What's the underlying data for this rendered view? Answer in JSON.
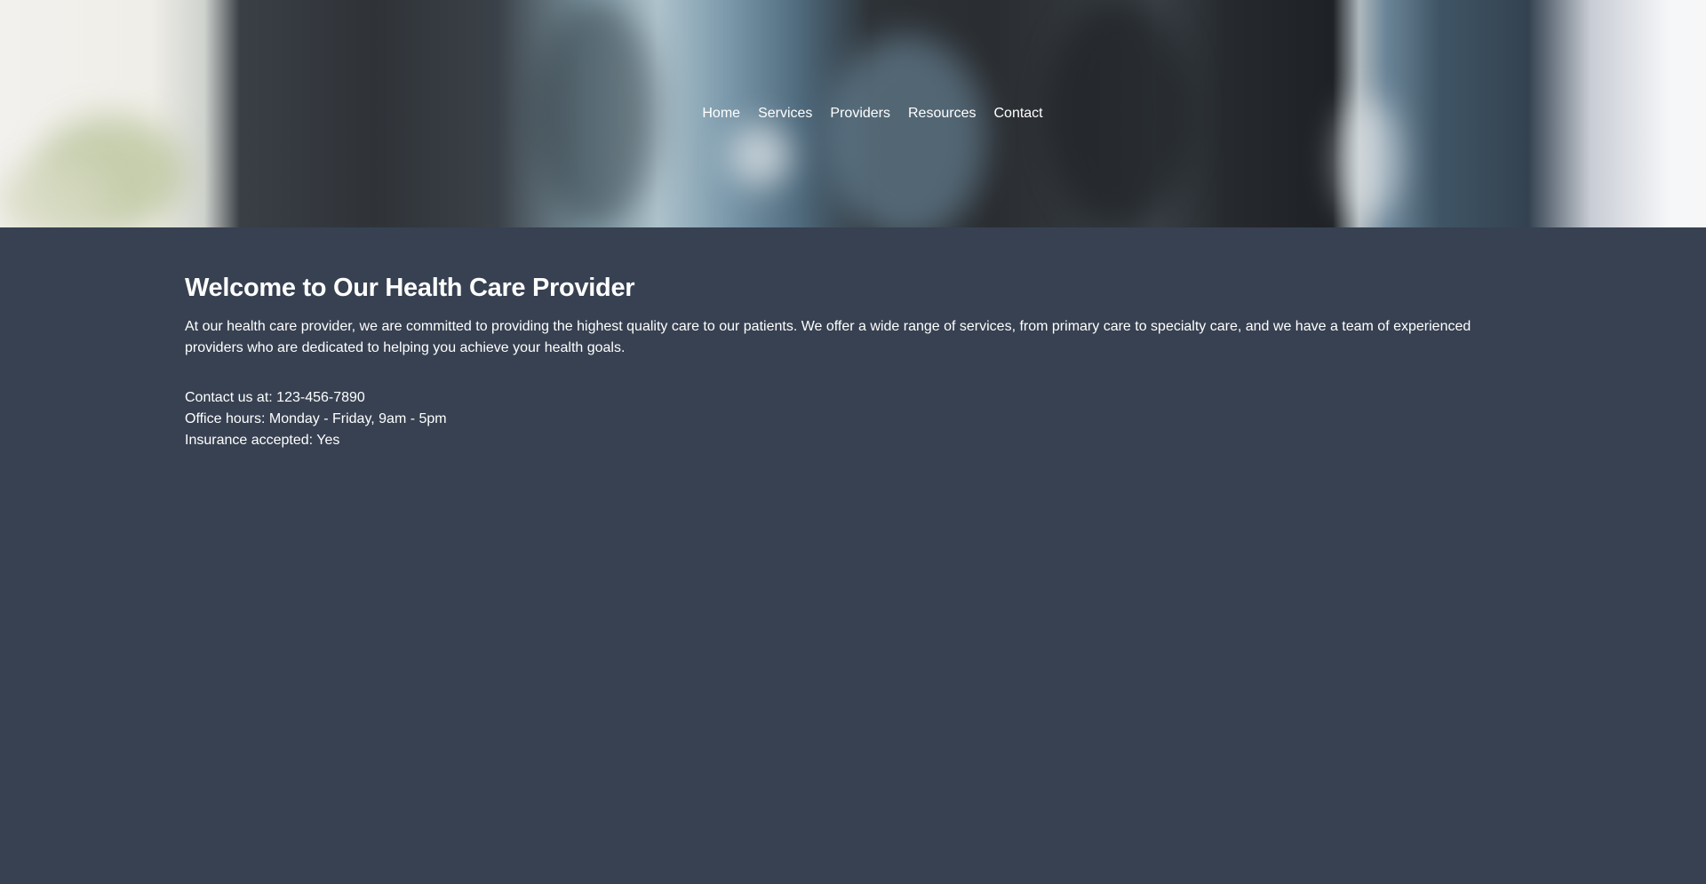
{
  "nav": {
    "items": [
      {
        "label": "Home"
      },
      {
        "label": "Services"
      },
      {
        "label": "Providers"
      },
      {
        "label": "Resources"
      },
      {
        "label": "Contact"
      }
    ]
  },
  "main": {
    "title": "Welcome to Our Health Care Provider",
    "intro": "At our health care provider, we are committed to providing the highest quality care to our patients. We offer a wide range of services, from primary care to specialty care, and we have a team of experienced providers who are dedicated to helping you achieve your health goals.",
    "contact_phone": "Contact us at: 123-456-7890",
    "office_hours": "Office hours: Monday - Friday, 9am - 5pm",
    "insurance": "Insurance accepted: Yes"
  },
  "colors": {
    "background": "#374151",
    "text": "#ffffff"
  }
}
